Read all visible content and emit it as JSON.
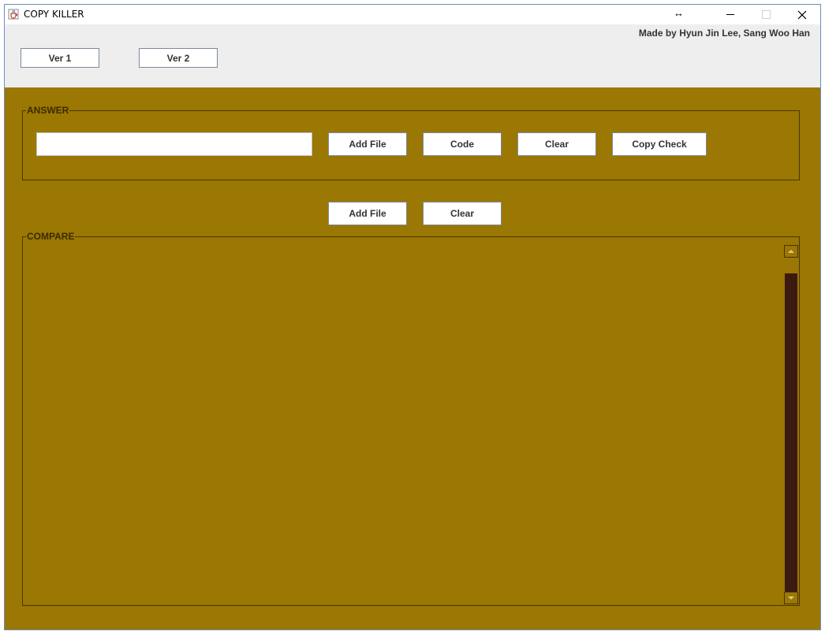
{
  "window": {
    "title": "COPY KILLER",
    "credit": "Made by Hyun Jin Lee, Sang Woo Han",
    "resize_glyph": "↔",
    "close_glyph": "✕"
  },
  "version_buttons": {
    "ver1": "Ver 1",
    "ver2": "Ver 2"
  },
  "answer": {
    "legend": "ANSWER",
    "file_path_value": "",
    "buttons": {
      "add_file": "Add File",
      "code": "Code",
      "clear": "Clear",
      "copy_check": "Copy Check"
    }
  },
  "compare_controls": {
    "add_file": "Add File",
    "clear": "Clear"
  },
  "compare": {
    "legend": "COMPARE"
  },
  "colors": {
    "panel_background": "#9b7703",
    "scroll_thumb": "#3d1a0f",
    "top_bar": "#eeeeee"
  },
  "icons": {
    "app": "java-coffee-cup-icon",
    "resize": "resize-horizontal-icon",
    "minimize": "minimize-icon",
    "maximize": "maximize-icon",
    "close": "close-icon"
  }
}
